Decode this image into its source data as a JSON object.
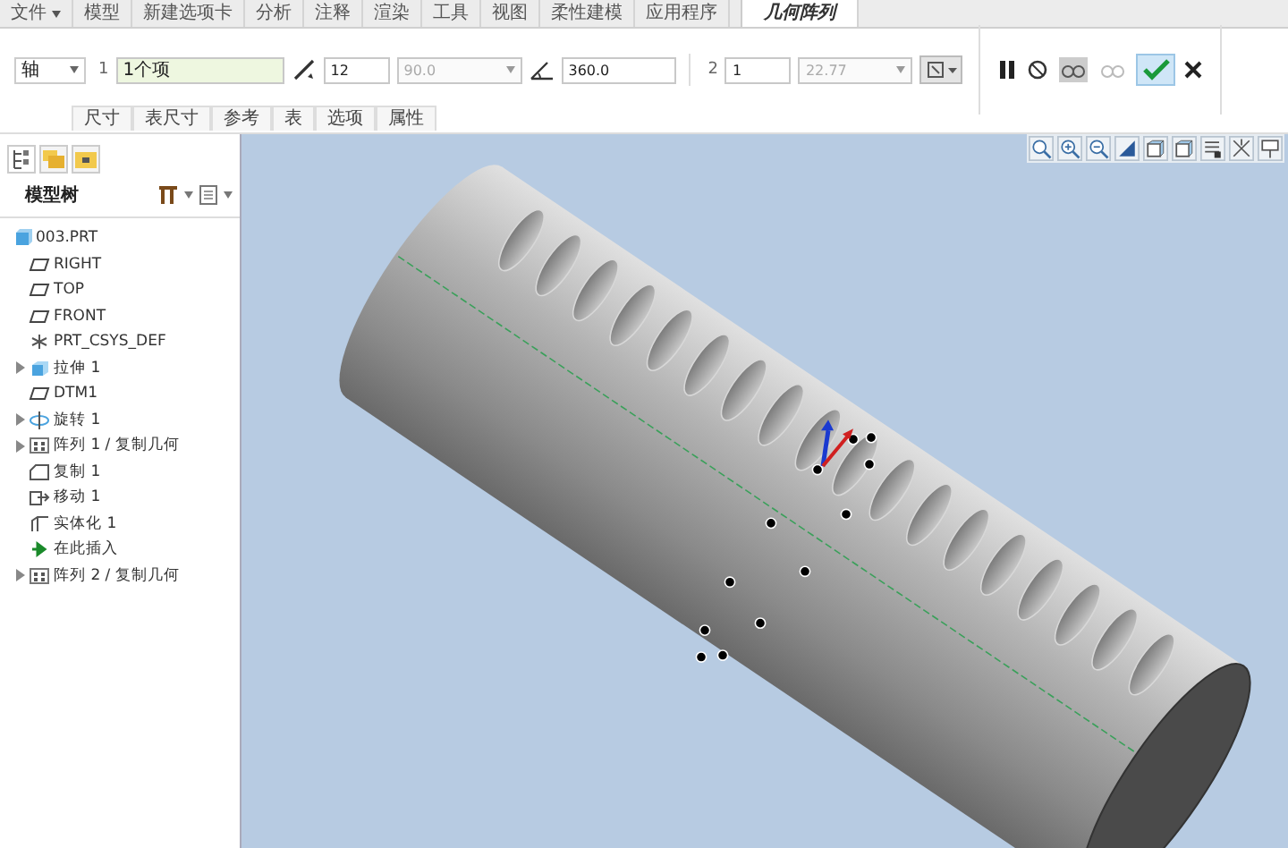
{
  "menu_tabs": [
    {
      "label": "文件",
      "kind": "menu",
      "selected": false
    },
    {
      "label": "模型",
      "kind": "tab",
      "selected": false
    },
    {
      "label": "新建选项卡",
      "kind": "tab",
      "selected": false
    },
    {
      "label": "分析",
      "kind": "tab",
      "selected": false
    },
    {
      "label": "注释",
      "kind": "tab",
      "selected": false
    },
    {
      "label": "渲染",
      "kind": "tab",
      "selected": false
    },
    {
      "label": "工具",
      "kind": "tab",
      "selected": false
    },
    {
      "label": "视图",
      "kind": "tab",
      "selected": false
    },
    {
      "label": "柔性建模",
      "kind": "tab",
      "selected": false
    },
    {
      "label": "应用程序",
      "kind": "tab",
      "selected": false
    },
    {
      "label": "几何阵列",
      "kind": "tab",
      "selected": true
    }
  ],
  "pattern_bar": {
    "type_dropdown": "轴",
    "direction_1": {
      "index": "1",
      "collector": "1个项",
      "member_count": "12",
      "spacing": "90.0",
      "spacing_disabled": true,
      "angle_range": "360.0"
    },
    "direction_2": {
      "index": "2",
      "member_count": "1",
      "spacing": "22.77",
      "spacing_disabled": true
    }
  },
  "sub_tabs": [
    {
      "label": "尺寸"
    },
    {
      "label": "表尺寸"
    },
    {
      "label": "参考"
    },
    {
      "label": "表"
    },
    {
      "label": "选项"
    },
    {
      "label": "属性"
    }
  ],
  "model_tree": {
    "title": "模型树",
    "items": [
      {
        "label": "003.PRT",
        "kind": "part",
        "expandable": false,
        "children": [
          {
            "label": "RIGHT",
            "kind": "plane",
            "expandable": false
          },
          {
            "label": "TOP",
            "kind": "plane",
            "expandable": false
          },
          {
            "label": "FRONT",
            "kind": "plane",
            "expandable": false
          },
          {
            "label": "PRT_CSYS_DEF",
            "kind": "csys",
            "expandable": false
          },
          {
            "label": "拉伸 1",
            "kind": "extrude",
            "expandable": true
          },
          {
            "label": "DTM1",
            "kind": "plane",
            "expandable": false
          },
          {
            "label": "旋转 1",
            "kind": "revolve",
            "expandable": true
          },
          {
            "label": "阵列 1 / 复制几何",
            "kind": "pattern",
            "expandable": true
          },
          {
            "label": "复制 1",
            "kind": "copy",
            "expandable": false
          },
          {
            "label": "移动 1",
            "kind": "move",
            "expandable": false
          },
          {
            "label": "实体化 1",
            "kind": "solidify",
            "expandable": false
          },
          {
            "label": "在此插入",
            "kind": "insert",
            "expandable": false
          },
          {
            "label": "阵列 2 / 复制几何",
            "kind": "pattern",
            "expandable": true
          }
        ]
      }
    ]
  }
}
